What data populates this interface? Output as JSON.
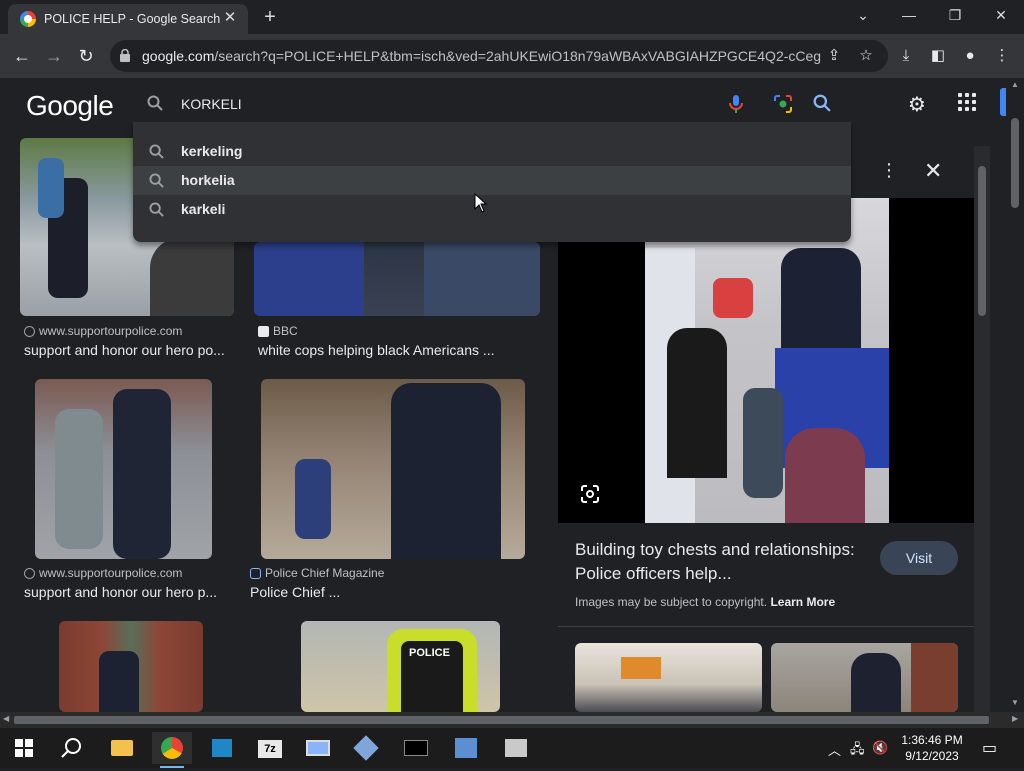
{
  "tab": {
    "title": "POLICE HELP - Google Search",
    "close": "✕",
    "new_tab": "+"
  },
  "window_controls": {
    "list": "⌄",
    "minimize": "—",
    "restore": "❐",
    "close": "✕"
  },
  "address": {
    "host": "google.com",
    "path": "/search?q=POLICE+HELP&tbm=isch&ved=2ahUKEwiO18n79aWBAxVABGIAHZPGCE4Q2-cCeg..."
  },
  "search": {
    "logo": "Google",
    "query": "KORKELI",
    "suggestions": [
      "kerkeling",
      "horkelia",
      "karkeli"
    ]
  },
  "results": [
    {
      "source": "www.supportourpolice.com",
      "caption": "support and honor our hero po..."
    },
    {
      "source": "BBC",
      "caption": "white cops helping black Americans ..."
    },
    {
      "source": "www.supportourpolice.com",
      "caption": "support and honor our hero p..."
    },
    {
      "source": "Police Chief Magazine",
      "caption": "Police Chief ..."
    }
  ],
  "thumb_labels": {
    "police_vest": "POLICE"
  },
  "preview": {
    "title": "Building toy chests and relationships: Police officers help...",
    "visit": "Visit",
    "copyright": "Images may be subject to copyright.",
    "learn_more": "Learn More"
  },
  "taskbar": {
    "time": "1:36:46 PM",
    "date": "9/12/2023"
  },
  "icons": [
    "google-favicon",
    "back-icon",
    "forward-icon",
    "reload-icon",
    "lock-icon",
    "share-icon",
    "star-icon",
    "download-icon",
    "sidebar-icon",
    "profile-icon",
    "menu-icon",
    "search-icon",
    "mic-icon",
    "lens-icon",
    "settings-icon",
    "apps-icon",
    "more-icon",
    "close-icon"
  ],
  "colors": {
    "bg": "#202124",
    "chrome": "#35363a",
    "accent_blue": "#4285f4",
    "visit_bg": "#394457"
  }
}
